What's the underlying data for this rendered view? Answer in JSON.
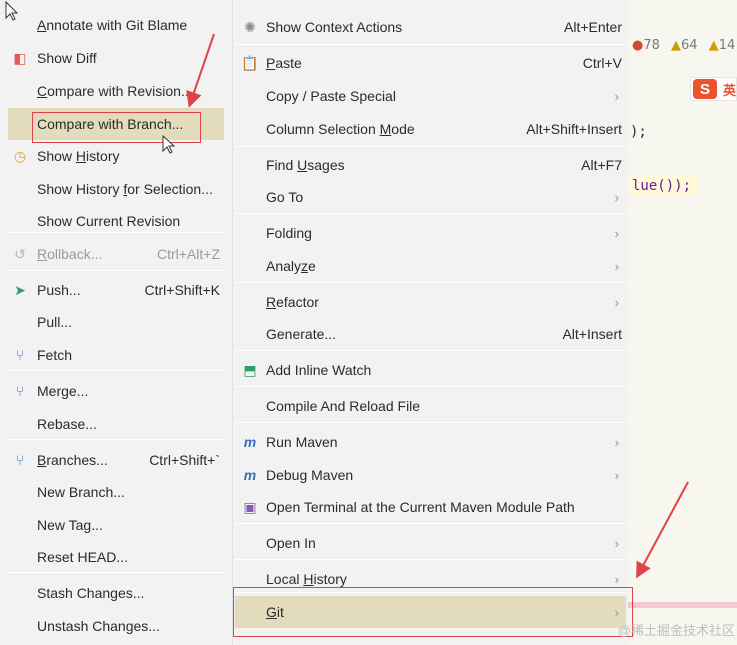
{
  "left_menu": {
    "items": [
      {
        "label_pre": "",
        "label_u": "A",
        "label_post": "nnotate with Git Blame",
        "shortcut": "",
        "icon": ""
      },
      {
        "label_pre": "Show Diff",
        "label_u": "",
        "label_post": "",
        "shortcut": "",
        "icon": "diff-icon"
      },
      {
        "label_pre": "",
        "label_u": "C",
        "label_post": "ompare with Revision...",
        "shortcut": "",
        "icon": ""
      },
      {
        "label_pre": "Compare with Branch...",
        "label_u": "",
        "label_post": "",
        "shortcut": "",
        "icon": ""
      },
      {
        "label_pre": "Show ",
        "label_u": "H",
        "label_post": "istory",
        "shortcut": "",
        "icon": "history-icon"
      },
      {
        "label_pre": "Show History ",
        "label_u": "f",
        "label_post": "or Selection...",
        "shortcut": "",
        "icon": ""
      },
      {
        "label_pre": "Show Current Revision",
        "label_u": "",
        "label_post": "",
        "shortcut": "",
        "icon": ""
      },
      {
        "label_pre": "",
        "label_u": "R",
        "label_post": "ollback...",
        "shortcut": "Ctrl+Alt+Z",
        "icon": "rollback-icon"
      },
      {
        "label_pre": "Push...",
        "label_u": "",
        "label_post": "",
        "shortcut": "Ctrl+Shift+K",
        "icon": "push-icon"
      },
      {
        "label_pre": "Pull...",
        "label_u": "",
        "label_post": "",
        "shortcut": "",
        "icon": ""
      },
      {
        "label_pre": "Fetch",
        "label_u": "",
        "label_post": "",
        "shortcut": "",
        "icon": "fetch-icon"
      },
      {
        "label_pre": "Merge...",
        "label_u": "",
        "label_post": "",
        "shortcut": "",
        "icon": "merge-icon"
      },
      {
        "label_pre": "Rebase...",
        "label_u": "",
        "label_post": "",
        "shortcut": "",
        "icon": ""
      },
      {
        "label_pre": "",
        "label_u": "B",
        "label_post": "ranches...",
        "shortcut": "Ctrl+Shift+`",
        "icon": "branches-icon"
      },
      {
        "label_pre": "New Branch...",
        "label_u": "",
        "label_post": "",
        "shortcut": "",
        "icon": ""
      },
      {
        "label_pre": "New Tag...",
        "label_u": "",
        "label_post": "",
        "shortcut": "",
        "icon": ""
      },
      {
        "label_pre": "Reset HEAD...",
        "label_u": "",
        "label_post": "",
        "shortcut": "",
        "icon": ""
      },
      {
        "label_pre": "Stash Changes...",
        "label_u": "",
        "label_post": "",
        "shortcut": "",
        "icon": ""
      },
      {
        "label_pre": "Unstash Changes...",
        "label_u": "",
        "label_post": "",
        "shortcut": "",
        "icon": ""
      }
    ]
  },
  "right_menu": {
    "items": [
      {
        "label_pre": "Show Context Actions",
        "label_u": "",
        "label_post": "",
        "shortcut": "Alt+Enter",
        "arrow": "",
        "icon": "bulb-icon"
      },
      {
        "label_pre": "",
        "label_u": "P",
        "label_post": "aste",
        "shortcut": "Ctrl+V",
        "arrow": "",
        "icon": "paste-icon"
      },
      {
        "label_pre": "Copy / Paste Special",
        "label_u": "",
        "label_post": "",
        "shortcut": "",
        "arrow": "›",
        "icon": ""
      },
      {
        "label_pre": "Column Selection ",
        "label_u": "M",
        "label_post": "ode",
        "shortcut": "Alt+Shift+Insert",
        "arrow": "",
        "icon": ""
      },
      {
        "label_pre": "Find ",
        "label_u": "U",
        "label_post": "sages",
        "shortcut": "Alt+F7",
        "arrow": "",
        "icon": ""
      },
      {
        "label_pre": "Go To",
        "label_u": "",
        "label_post": "",
        "shortcut": "",
        "arrow": "›",
        "icon": ""
      },
      {
        "label_pre": "Folding",
        "label_u": "",
        "label_post": "",
        "shortcut": "",
        "arrow": "›",
        "icon": ""
      },
      {
        "label_pre": "Analy",
        "label_u": "z",
        "label_post": "e",
        "shortcut": "",
        "arrow": "›",
        "icon": ""
      },
      {
        "label_pre": "",
        "label_u": "R",
        "label_post": "efactor",
        "shortcut": "",
        "arrow": "›",
        "icon": ""
      },
      {
        "label_pre": "Generate...",
        "label_u": "",
        "label_post": "",
        "shortcut": "Alt+Insert",
        "arrow": "",
        "icon": ""
      },
      {
        "label_pre": "Add Inline Watch",
        "label_u": "",
        "label_post": "",
        "shortcut": "",
        "arrow": "",
        "icon": "watch-icon"
      },
      {
        "label_pre": "Compile And Reload File",
        "label_u": "",
        "label_post": "",
        "shortcut": "",
        "arrow": "",
        "icon": ""
      },
      {
        "label_pre": "Run Maven",
        "label_u": "",
        "label_post": "",
        "shortcut": "",
        "arrow": "›",
        "icon": "maven-run-icon"
      },
      {
        "label_pre": "Debug Maven",
        "label_u": "",
        "label_post": "",
        "shortcut": "",
        "arrow": "›",
        "icon": "maven-debug-icon"
      },
      {
        "label_pre": "Open Terminal at the Current Maven Module Path",
        "label_u": "",
        "label_post": "",
        "shortcut": "",
        "arrow": "",
        "icon": "terminal-icon"
      },
      {
        "label_pre": "Open In",
        "label_u": "",
        "label_post": "",
        "shortcut": "",
        "arrow": "›",
        "icon": ""
      },
      {
        "label_pre": "Local ",
        "label_u": "H",
        "label_post": "istory",
        "shortcut": "",
        "arrow": "›",
        "icon": ""
      },
      {
        "label_pre": "",
        "label_u": "G",
        "label_post": "it",
        "shortcut": "",
        "arrow": "›",
        "icon": ""
      }
    ]
  },
  "editor": {
    "err_count": "78",
    "warn_count": "64",
    "weak_count": "14",
    "code_line1": ");",
    "code_line2": "lue());",
    "sogou_char": "S",
    "sogou_text": "英"
  },
  "watermark": "@稀土掘金技术社区"
}
